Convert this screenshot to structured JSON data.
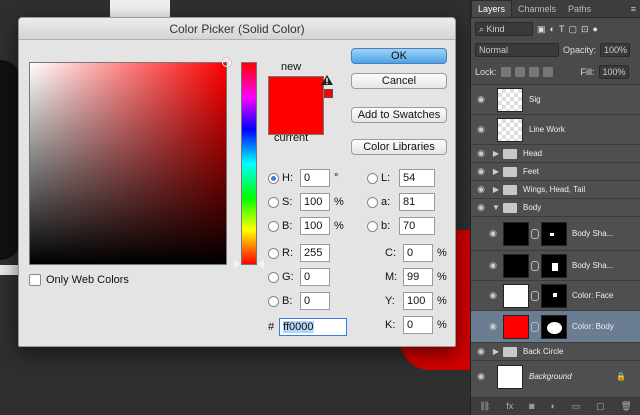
{
  "dialog": {
    "title": "Color Picker (Solid Color)",
    "ok_label": "OK",
    "cancel_label": "Cancel",
    "add_swatches_label": "Add to Swatches",
    "color_libraries_label": "Color Libraries",
    "new_label": "new",
    "current_label": "current",
    "only_web_colors_label": "Only Web Colors",
    "fields": {
      "H": {
        "label": "H:",
        "value": "0",
        "unit": "°"
      },
      "S": {
        "label": "S:",
        "value": "100",
        "unit": "%"
      },
      "Bv": {
        "label": "B:",
        "value": "100",
        "unit": "%"
      },
      "R": {
        "label": "R:",
        "value": "255"
      },
      "G": {
        "label": "G:",
        "value": "0"
      },
      "Bc": {
        "label": "B:",
        "value": "0"
      },
      "L": {
        "label": "L:",
        "value": "54"
      },
      "a": {
        "label": "a:",
        "value": "81"
      },
      "b": {
        "label": "b:",
        "value": "70"
      },
      "C": {
        "label": "C:",
        "value": "0",
        "unit": "%"
      },
      "M": {
        "label": "M:",
        "value": "99",
        "unit": "%"
      },
      "Y": {
        "label": "Y:",
        "value": "100",
        "unit": "%"
      },
      "K": {
        "label": "K:",
        "value": "0",
        "unit": "%"
      }
    },
    "hex_label": "#",
    "hex_value": "ff0000",
    "selected_color": "#ff0000"
  },
  "panel": {
    "tabs": [
      "Layers",
      "Channels",
      "Paths"
    ],
    "filter_kind": "Kind",
    "blend_mode": "Normal",
    "opacity_label": "Opacity:",
    "opacity_value": "100%",
    "lock_label": "Lock:",
    "fill_label": "Fill:",
    "fill_value": "100%",
    "layers": [
      {
        "name": "Sig"
      },
      {
        "name": "Line Work"
      },
      {
        "name": "Head"
      },
      {
        "name": "Feet"
      },
      {
        "name": "Wings, Head, Tail"
      },
      {
        "name": "Body"
      },
      {
        "name": "Body Sha..."
      },
      {
        "name": "Body Sha..."
      },
      {
        "name": "Color: Face"
      },
      {
        "name": "Color: Body"
      },
      {
        "name": "Back Circle"
      },
      {
        "name": "Background"
      }
    ]
  }
}
